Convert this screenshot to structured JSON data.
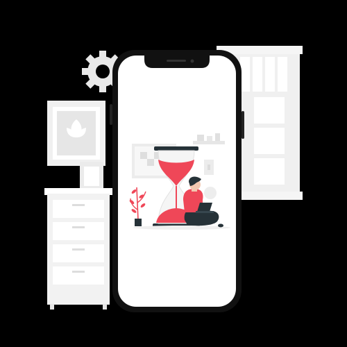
{
  "scene": {
    "background_color": "#000000",
    "accent_color": "#ef4758",
    "phone_frame_color": "#111111",
    "screen_color": "#ffffff",
    "furniture_color": "#f2f2f2",
    "icons": [
      "gear-icon",
      "plant-frame-icon",
      "hourglass-icon",
      "laptop-icon",
      "plant-icon"
    ]
  }
}
